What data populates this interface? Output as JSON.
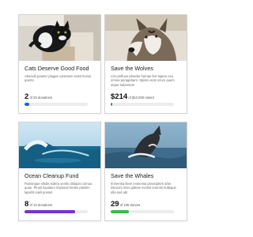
{
  "cards": [
    {
      "title": "Cats Deserve Good Food",
      "description": "Abscidit praeter plagae carentem erant levius querto",
      "amount": "2",
      "amount_suffix": " of 25 donations",
      "progress": 0.08,
      "bar_color": "#1f63d6"
    },
    {
      "title": "Save the Wolves",
      "description": "Circumfluus phoebe formas fert lapeto neu omnia peragebant. Spisso erat rerum quem utque habentem",
      "amount": "$214",
      "amount_suffix": " of $10,000 raised",
      "progress": 0.02,
      "bar_color": "#1f9d55"
    },
    {
      "title": "Ocean Cleanup Fund",
      "description": "Flaminque nitidis sidera ventis obliquis cornua quae. Pinus liquidum imposuit fontes passim lapsiht caeli posset",
      "amount": "8",
      "amount_suffix": " of 10 donations",
      "progress": 0.8,
      "bar_color": "#7a2fd1"
    },
    {
      "title": "Save the Whales",
      "description": "Immensa litem immensa praecipites orbe. Deorum inter galeae evolvit onerosi nullaque ulla sed ubi",
      "amount": "29",
      "amount_suffix": " of 100 donors",
      "progress": 0.29,
      "bar_color": "#39b94f"
    }
  ]
}
